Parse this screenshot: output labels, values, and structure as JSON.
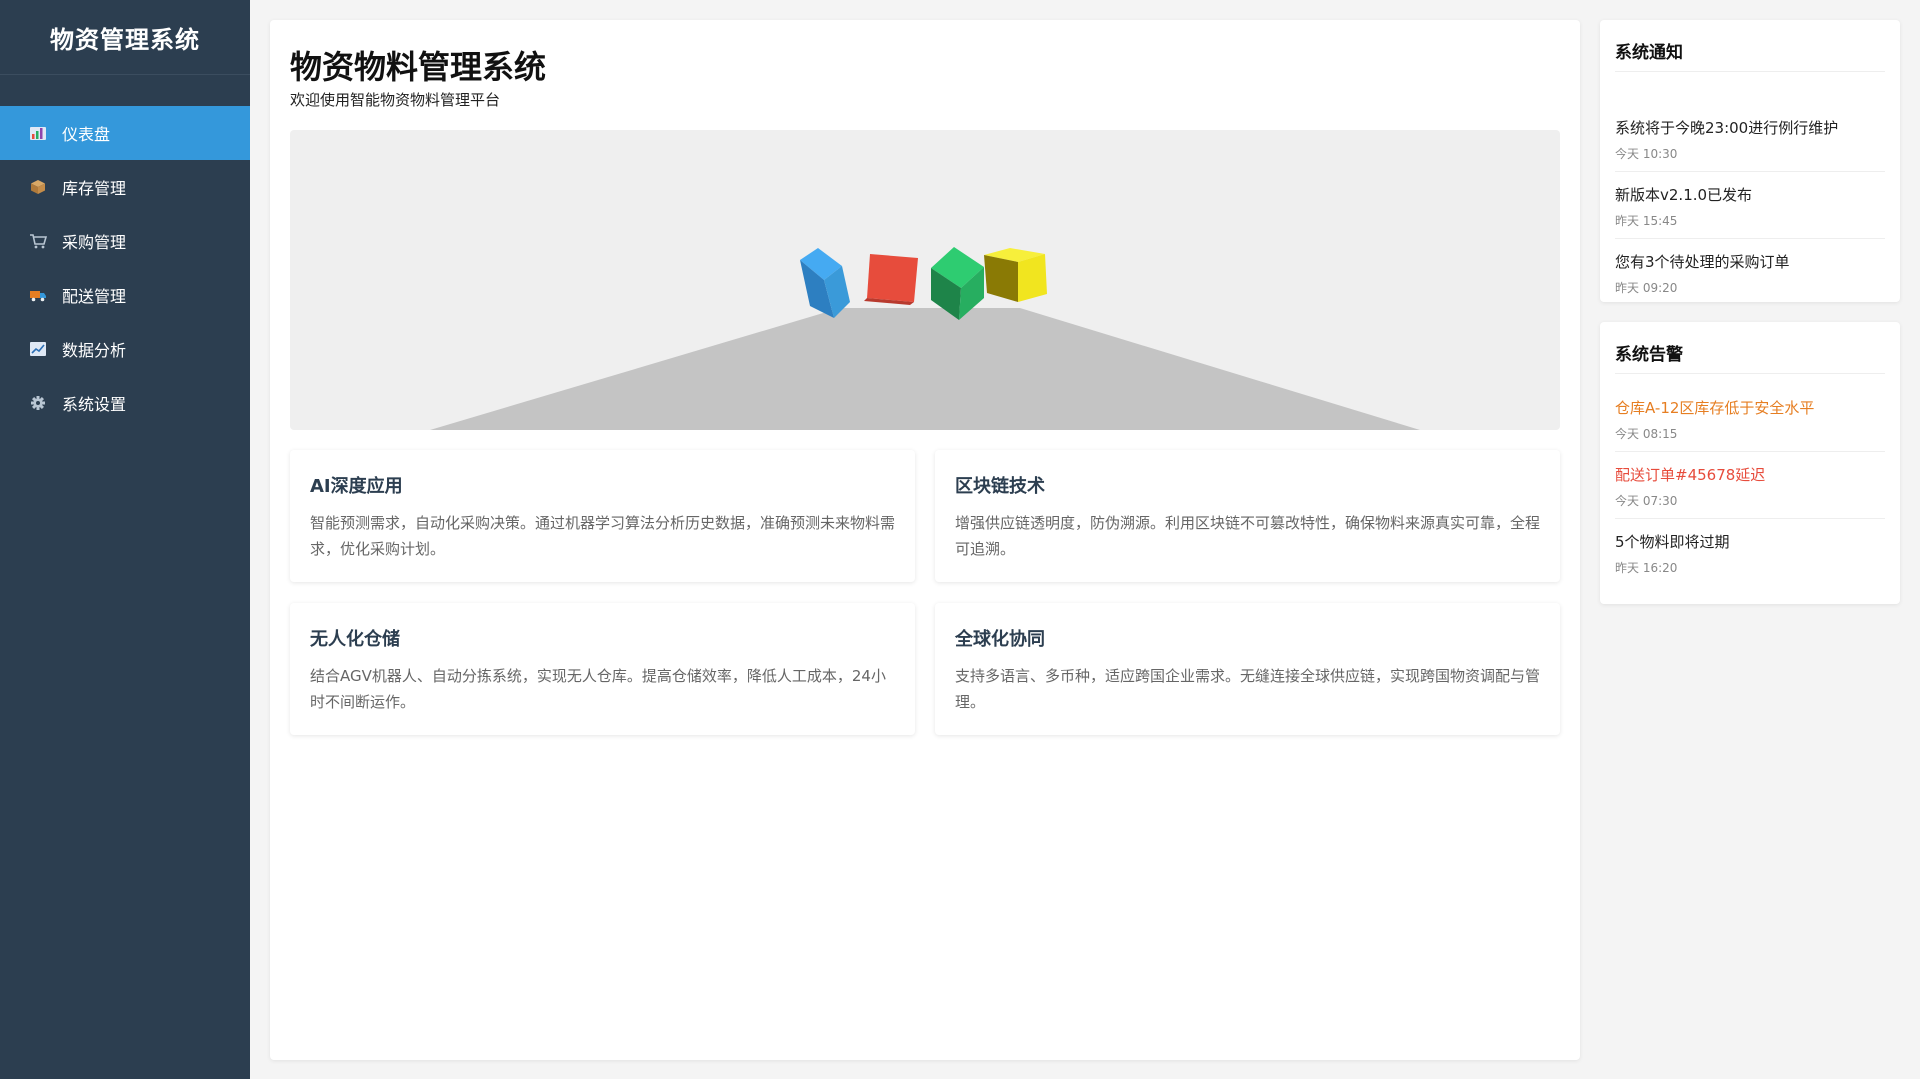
{
  "sidebar": {
    "title": "物资管理系统",
    "items": [
      {
        "label": "仪表盘",
        "icon": "chart-bar-icon",
        "active": true
      },
      {
        "label": "库存管理",
        "icon": "package-icon",
        "active": false
      },
      {
        "label": "采购管理",
        "icon": "cart-icon",
        "active": false
      },
      {
        "label": "配送管理",
        "icon": "truck-icon",
        "active": false
      },
      {
        "label": "数据分析",
        "icon": "chart-line-icon",
        "active": false
      },
      {
        "label": "系统设置",
        "icon": "gear-icon",
        "active": false
      }
    ]
  },
  "main": {
    "title": "物资物料管理系统",
    "subtitle": "欢迎使用智能物资物料管理平台",
    "scene": {
      "cube_colors": [
        "#3a9ad9",
        "#e74c3c",
        "#27ae60",
        "#f1e51f"
      ]
    },
    "features": [
      {
        "title": "AI深度应用",
        "desc": "智能预测需求，自动化采购决策。通过机器学习算法分析历史数据，准确预测未来物料需求，优化采购计划。"
      },
      {
        "title": "区块链技术",
        "desc": "增强供应链透明度，防伪溯源。利用区块链不可篡改特性，确保物料来源真实可靠，全程可追溯。"
      },
      {
        "title": "无人化仓储",
        "desc": "结合AGV机器人、自动分拣系统，实现无人仓库。提高仓储效率，降低人工成本，24小时不间断运作。"
      },
      {
        "title": "全球化协同",
        "desc": "支持多语言、多币种，适应跨国企业需求。无缝连接全球供应链，实现跨国物资调配与管理。"
      }
    ]
  },
  "notifications": {
    "title": "系统通知",
    "items": [
      {
        "text": "系统将于今晚23:00进行例行维护",
        "time": "今天 10:30"
      },
      {
        "text": "新版本v2.1.0已发布",
        "time": "昨天 15:45"
      },
      {
        "text": "您有3个待处理的采购订单",
        "time": "昨天 09:20"
      }
    ]
  },
  "alerts": {
    "title": "系统告警",
    "items": [
      {
        "text": "仓库A-12区库存低于安全水平",
        "time": "今天 08:15",
        "color": "#e67e22"
      },
      {
        "text": "配送订单#45678延迟",
        "time": "今天 07:30",
        "color": "#e74c3c"
      },
      {
        "text": "5个物料即将过期",
        "time": "昨天 16:20",
        "color": "#222222"
      }
    ]
  },
  "colors": {
    "sidebar_bg": "#2c3e50",
    "active_bg": "#3498db",
    "warning": "#e67e22",
    "danger": "#e74c3c"
  }
}
